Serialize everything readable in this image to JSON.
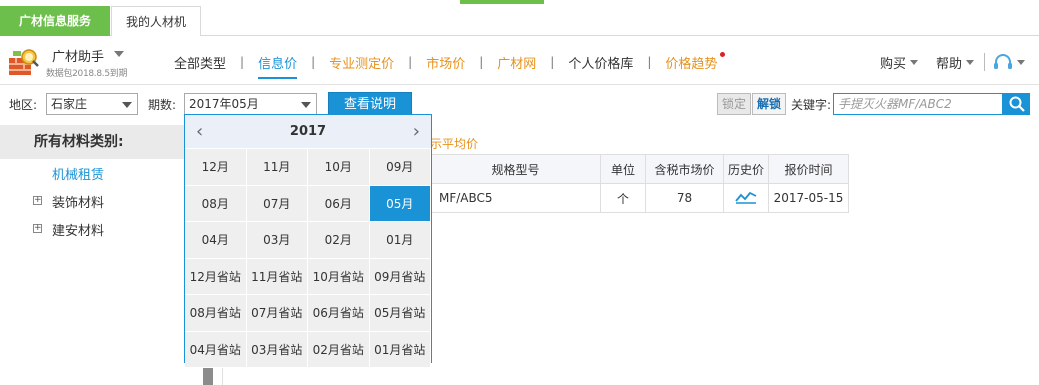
{
  "top_tabs": {
    "active": "广材信息服务",
    "other": "我的人材机"
  },
  "brand": {
    "name": "广材助手",
    "sub": "数据包2018.8.5到期"
  },
  "nav": [
    {
      "label": "全部类型",
      "color": "dark"
    },
    {
      "label": "信息价",
      "color": "blue",
      "active": true
    },
    {
      "label": "专业测定价",
      "color": "orange"
    },
    {
      "label": "市场价",
      "color": "orange"
    },
    {
      "label": "广材网",
      "color": "orange"
    },
    {
      "label": "个人价格库",
      "color": "dark"
    },
    {
      "label": "价格趋势",
      "color": "orange",
      "badge": true
    }
  ],
  "right_menu": {
    "buy": "购买",
    "help": "帮助"
  },
  "filters": {
    "region_label": "地区:",
    "region_value": "石家庄",
    "period_label": "期数:",
    "period_value": "2017年05月",
    "view_button": "查看说明",
    "lock": "锁定",
    "unlock": "解锁",
    "keyword_label": "关键字:",
    "keyword_placeholder": "手提灭火器MF/ABC2"
  },
  "sidebar": {
    "title": "所有材料类别:",
    "items": [
      {
        "label": "机械租赁",
        "selected": true
      },
      {
        "label": "装饰材料",
        "expandable": true
      },
      {
        "label": "建安材料",
        "expandable": true
      }
    ]
  },
  "table": {
    "avg_text": "示平均价",
    "headers": [
      "规格型号",
      "单位",
      "含税市场价",
      "历史价",
      "报价时间"
    ],
    "rows": [
      {
        "spec": "MF/ABC5",
        "unit": "个",
        "price": "78",
        "date": "2017-05-15"
      }
    ]
  },
  "calendar": {
    "year": "2017",
    "prev": "‹",
    "next": "›",
    "cells": [
      "12月",
      "11月",
      "10月",
      "09月",
      "08月",
      "07月",
      "06月",
      "05月",
      "04月",
      "03月",
      "02月",
      "01月",
      "12月省站",
      "11月省站",
      "10月省站",
      "09月省站",
      "08月省站",
      "07月省站",
      "06月省站",
      "05月省站",
      "04月省站",
      "03月省站",
      "02月省站",
      "01月省站"
    ],
    "selected": "05月"
  },
  "colors": {
    "accent": "#1a93d6",
    "green": "#6cbf4a",
    "orange": "#e8911c"
  }
}
